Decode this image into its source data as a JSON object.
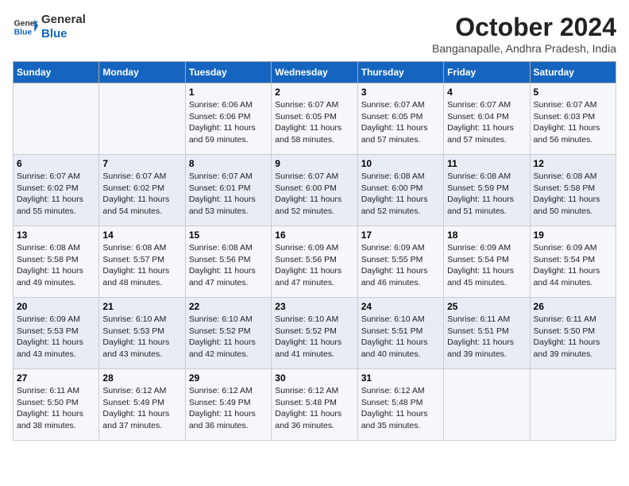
{
  "header": {
    "logo_line1": "General",
    "logo_line2": "Blue",
    "month": "October 2024",
    "location": "Banganapalle, Andhra Pradesh, India"
  },
  "columns": [
    "Sunday",
    "Monday",
    "Tuesday",
    "Wednesday",
    "Thursday",
    "Friday",
    "Saturday"
  ],
  "weeks": [
    [
      {
        "day": "",
        "info": ""
      },
      {
        "day": "",
        "info": ""
      },
      {
        "day": "1",
        "info": "Sunrise: 6:06 AM\nSunset: 6:06 PM\nDaylight: 11 hours and 59 minutes."
      },
      {
        "day": "2",
        "info": "Sunrise: 6:07 AM\nSunset: 6:05 PM\nDaylight: 11 hours and 58 minutes."
      },
      {
        "day": "3",
        "info": "Sunrise: 6:07 AM\nSunset: 6:05 PM\nDaylight: 11 hours and 57 minutes."
      },
      {
        "day": "4",
        "info": "Sunrise: 6:07 AM\nSunset: 6:04 PM\nDaylight: 11 hours and 57 minutes."
      },
      {
        "day": "5",
        "info": "Sunrise: 6:07 AM\nSunset: 6:03 PM\nDaylight: 11 hours and 56 minutes."
      }
    ],
    [
      {
        "day": "6",
        "info": "Sunrise: 6:07 AM\nSunset: 6:02 PM\nDaylight: 11 hours and 55 minutes."
      },
      {
        "day": "7",
        "info": "Sunrise: 6:07 AM\nSunset: 6:02 PM\nDaylight: 11 hours and 54 minutes."
      },
      {
        "day": "8",
        "info": "Sunrise: 6:07 AM\nSunset: 6:01 PM\nDaylight: 11 hours and 53 minutes."
      },
      {
        "day": "9",
        "info": "Sunrise: 6:07 AM\nSunset: 6:00 PM\nDaylight: 11 hours and 52 minutes."
      },
      {
        "day": "10",
        "info": "Sunrise: 6:08 AM\nSunset: 6:00 PM\nDaylight: 11 hours and 52 minutes."
      },
      {
        "day": "11",
        "info": "Sunrise: 6:08 AM\nSunset: 5:59 PM\nDaylight: 11 hours and 51 minutes."
      },
      {
        "day": "12",
        "info": "Sunrise: 6:08 AM\nSunset: 5:58 PM\nDaylight: 11 hours and 50 minutes."
      }
    ],
    [
      {
        "day": "13",
        "info": "Sunrise: 6:08 AM\nSunset: 5:58 PM\nDaylight: 11 hours and 49 minutes."
      },
      {
        "day": "14",
        "info": "Sunrise: 6:08 AM\nSunset: 5:57 PM\nDaylight: 11 hours and 48 minutes."
      },
      {
        "day": "15",
        "info": "Sunrise: 6:08 AM\nSunset: 5:56 PM\nDaylight: 11 hours and 47 minutes."
      },
      {
        "day": "16",
        "info": "Sunrise: 6:09 AM\nSunset: 5:56 PM\nDaylight: 11 hours and 47 minutes."
      },
      {
        "day": "17",
        "info": "Sunrise: 6:09 AM\nSunset: 5:55 PM\nDaylight: 11 hours and 46 minutes."
      },
      {
        "day": "18",
        "info": "Sunrise: 6:09 AM\nSunset: 5:54 PM\nDaylight: 11 hours and 45 minutes."
      },
      {
        "day": "19",
        "info": "Sunrise: 6:09 AM\nSunset: 5:54 PM\nDaylight: 11 hours and 44 minutes."
      }
    ],
    [
      {
        "day": "20",
        "info": "Sunrise: 6:09 AM\nSunset: 5:53 PM\nDaylight: 11 hours and 43 minutes."
      },
      {
        "day": "21",
        "info": "Sunrise: 6:10 AM\nSunset: 5:53 PM\nDaylight: 11 hours and 43 minutes."
      },
      {
        "day": "22",
        "info": "Sunrise: 6:10 AM\nSunset: 5:52 PM\nDaylight: 11 hours and 42 minutes."
      },
      {
        "day": "23",
        "info": "Sunrise: 6:10 AM\nSunset: 5:52 PM\nDaylight: 11 hours and 41 minutes."
      },
      {
        "day": "24",
        "info": "Sunrise: 6:10 AM\nSunset: 5:51 PM\nDaylight: 11 hours and 40 minutes."
      },
      {
        "day": "25",
        "info": "Sunrise: 6:11 AM\nSunset: 5:51 PM\nDaylight: 11 hours and 39 minutes."
      },
      {
        "day": "26",
        "info": "Sunrise: 6:11 AM\nSunset: 5:50 PM\nDaylight: 11 hours and 39 minutes."
      }
    ],
    [
      {
        "day": "27",
        "info": "Sunrise: 6:11 AM\nSunset: 5:50 PM\nDaylight: 11 hours and 38 minutes."
      },
      {
        "day": "28",
        "info": "Sunrise: 6:12 AM\nSunset: 5:49 PM\nDaylight: 11 hours and 37 minutes."
      },
      {
        "day": "29",
        "info": "Sunrise: 6:12 AM\nSunset: 5:49 PM\nDaylight: 11 hours and 36 minutes."
      },
      {
        "day": "30",
        "info": "Sunrise: 6:12 AM\nSunset: 5:48 PM\nDaylight: 11 hours and 36 minutes."
      },
      {
        "day": "31",
        "info": "Sunrise: 6:12 AM\nSunset: 5:48 PM\nDaylight: 11 hours and 35 minutes."
      },
      {
        "day": "",
        "info": ""
      },
      {
        "day": "",
        "info": ""
      }
    ]
  ]
}
